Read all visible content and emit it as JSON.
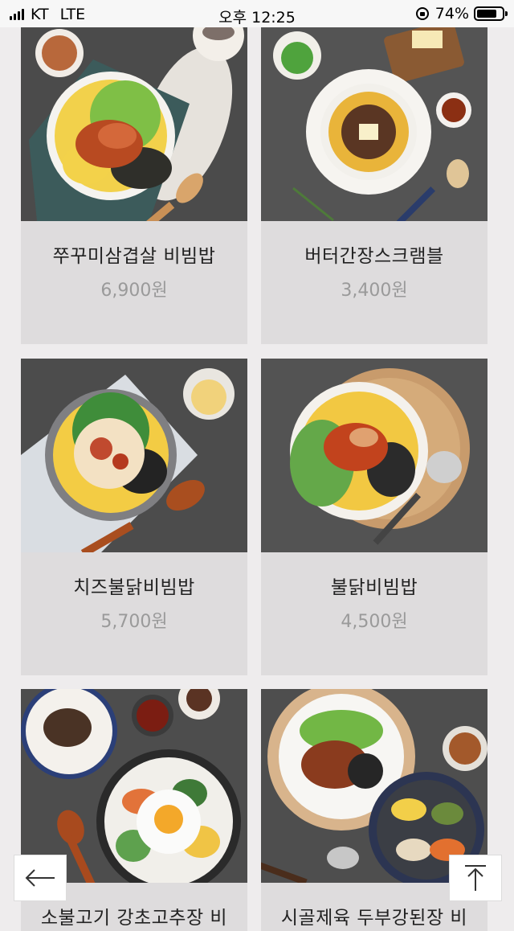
{
  "status_bar": {
    "carrier": "KT",
    "network": "LTE",
    "time": "오후 12:25",
    "battery": "74%",
    "battery_level": 0.74
  },
  "menu_items": [
    {
      "name": "쭈꾸미삼겹살 비빔밥",
      "price": "6,900원"
    },
    {
      "name": "버터간장스크램블",
      "price": "3,400원"
    },
    {
      "name": "치즈불닭비빔밥",
      "price": "5,700원"
    },
    {
      "name": "불닭비빔밥",
      "price": "4,500원"
    },
    {
      "name": "소불고기 강초고추장 비",
      "price": ""
    },
    {
      "name": "시골제육 두부강된장 비",
      "price": ""
    }
  ],
  "nav": {
    "back_icon": "arrow-left-icon",
    "top_icon": "arrow-up-icon"
  }
}
